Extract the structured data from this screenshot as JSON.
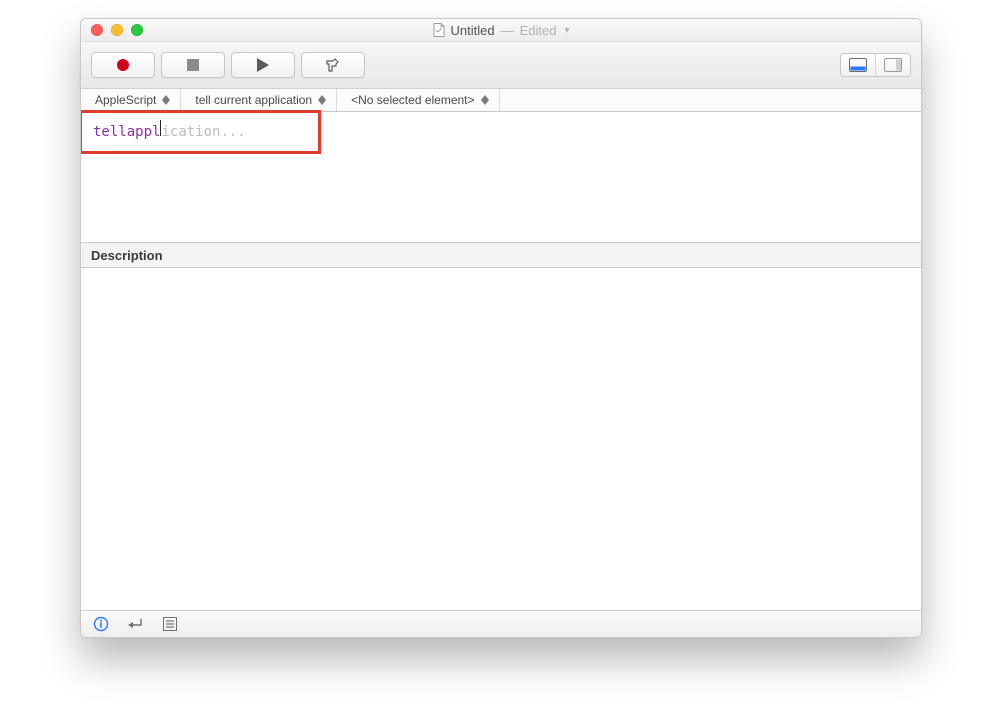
{
  "title": {
    "filename": "Untitled",
    "status_separator": "—",
    "status": "Edited"
  },
  "toolbar": {
    "record_label": "Record",
    "stop_label": "Stop",
    "run_label": "Run",
    "compile_label": "Compile",
    "pane_toggle_left_label": "Show Bottom Pane",
    "pane_toggle_right_label": "Hide Side Pane"
  },
  "navbar": {
    "language": "AppleScript",
    "scope": "tell current application",
    "element": "<No selected element>"
  },
  "editor": {
    "keyword": "tell",
    "typed_partial": " appl",
    "autocomplete_suffix": "ication..."
  },
  "description": {
    "header": "Description"
  },
  "annotation": {
    "highlight_target": "code-autocomplete-line"
  }
}
